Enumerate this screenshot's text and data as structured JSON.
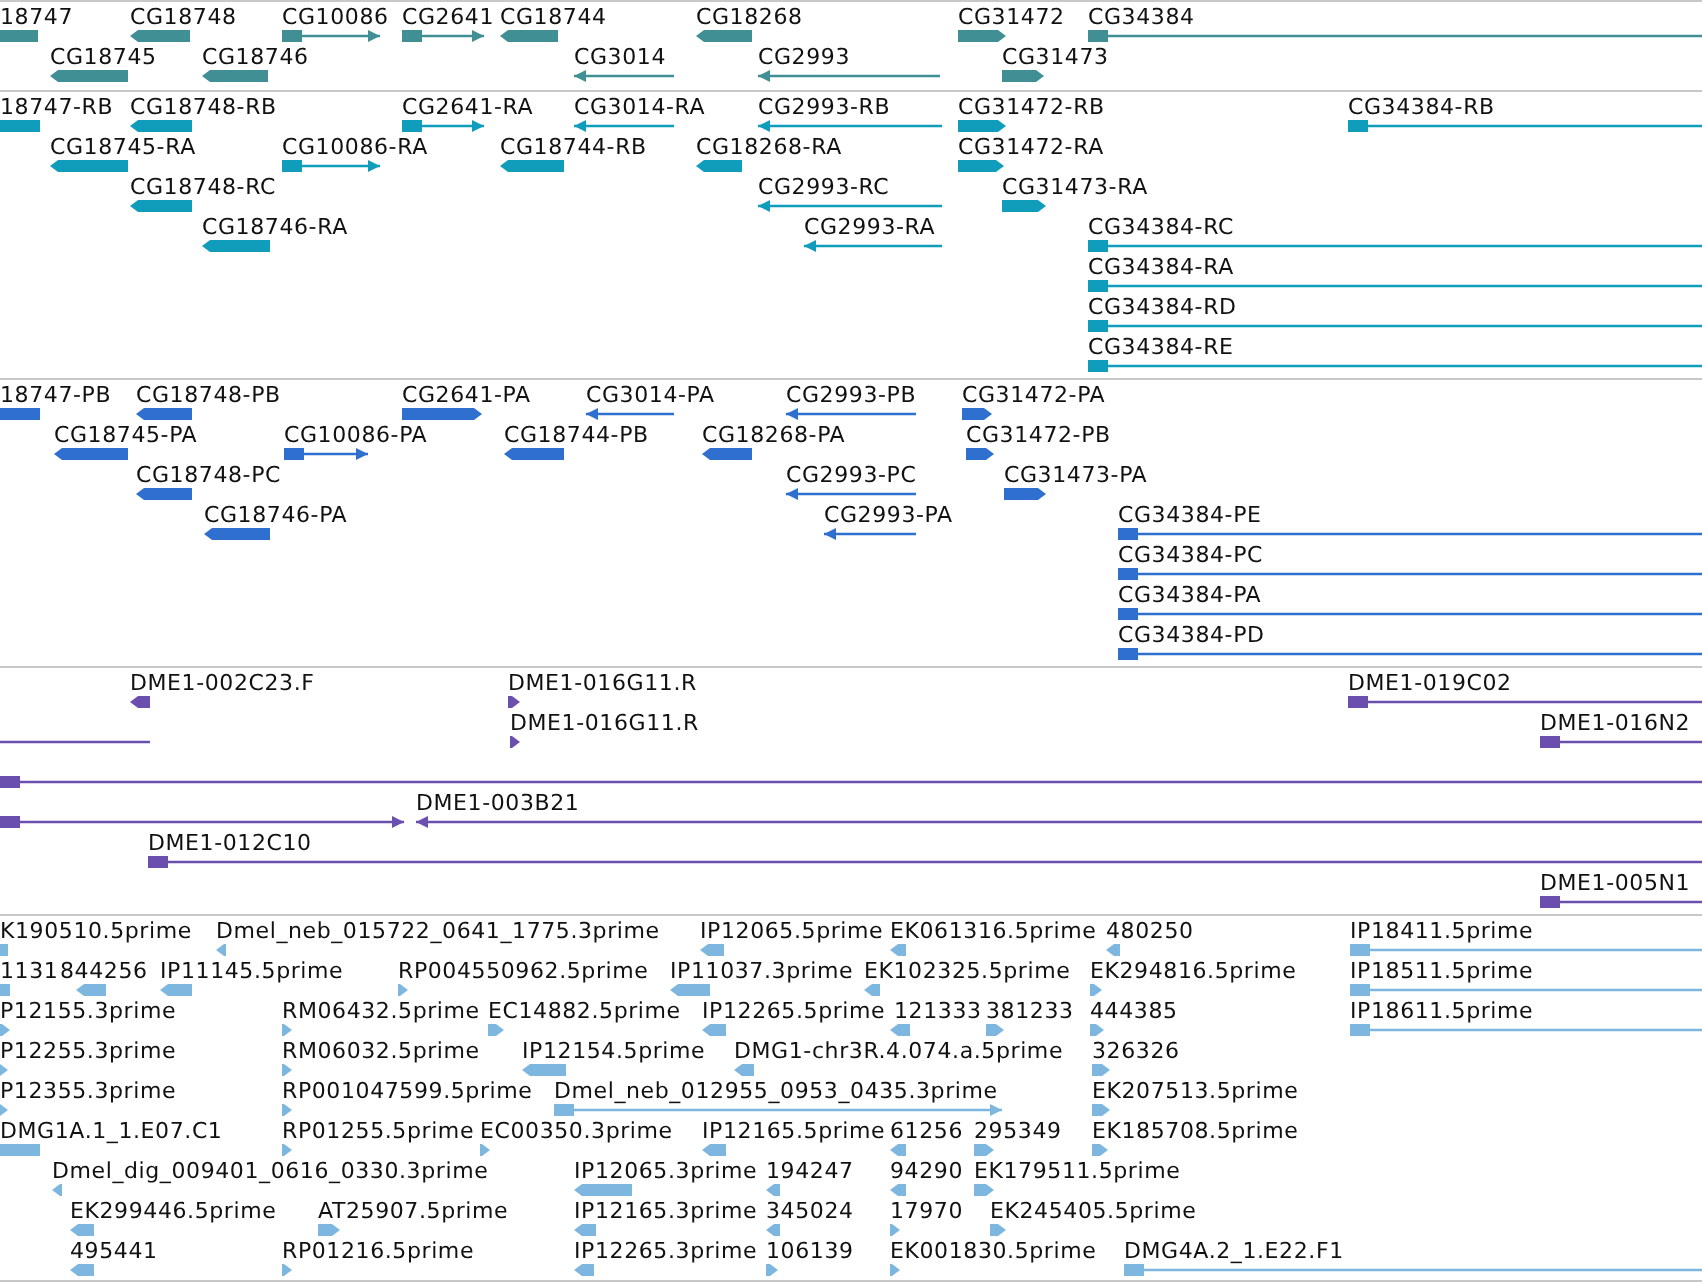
{
  "tracks": [
    {
      "color": "#3f8f94",
      "features": [
        {
          "label": "18747",
          "reverse_strand": true
        },
        {
          "label": "CG18748",
          "reverse_strand": true
        },
        {
          "label": "CG10086",
          "reverse_strand": false
        },
        {
          "label": "CG2641",
          "reverse_strand": false
        },
        {
          "label": "CG18744",
          "reverse_strand": true
        },
        {
          "label": "CG18268",
          "reverse_strand": true
        },
        {
          "label": "CG31472",
          "reverse_strand": false
        },
        {
          "label": "CG34384",
          "reverse_strand": false
        },
        {
          "label": "CG18745",
          "reverse_strand": true
        },
        {
          "label": "CG18746",
          "reverse_strand": true
        },
        {
          "label": "CG3014",
          "reverse_strand": true
        },
        {
          "label": "CG2993",
          "reverse_strand": true
        },
        {
          "label": "CG31473",
          "reverse_strand": false
        }
      ]
    },
    {
      "color": "#0f9dbb",
      "features": [
        {
          "label": "18747-RB",
          "reverse_strand": true
        },
        {
          "label": "CG18748-RB",
          "reverse_strand": true
        },
        {
          "label": "CG2641-RA",
          "reverse_strand": false
        },
        {
          "label": "CG3014-RA",
          "reverse_strand": true
        },
        {
          "label": "CG2993-RB",
          "reverse_strand": true
        },
        {
          "label": "CG31472-RB",
          "reverse_strand": false
        },
        {
          "label": "CG34384-RB",
          "reverse_strand": false
        },
        {
          "label": "CG18745-RA",
          "reverse_strand": true
        },
        {
          "label": "CG10086-RA",
          "reverse_strand": false
        },
        {
          "label": "CG18744-RB",
          "reverse_strand": true
        },
        {
          "label": "CG18268-RA",
          "reverse_strand": true
        },
        {
          "label": "CG31472-RA",
          "reverse_strand": false
        },
        {
          "label": "CG18748-RC",
          "reverse_strand": true
        },
        {
          "label": "CG2993-RC",
          "reverse_strand": true
        },
        {
          "label": "CG31473-RA",
          "reverse_strand": false
        },
        {
          "label": "CG18746-RA",
          "reverse_strand": true
        },
        {
          "label": "CG2993-RA",
          "reverse_strand": true
        },
        {
          "label": "CG34384-RC",
          "reverse_strand": false
        },
        {
          "label": "CG34384-RA",
          "reverse_strand": false
        },
        {
          "label": "CG34384-RD",
          "reverse_strand": false
        },
        {
          "label": "CG34384-RE",
          "reverse_strand": false
        }
      ]
    },
    {
      "color": "#2f6fd0",
      "features": [
        {
          "label": "18747-PB",
          "reverse_strand": true
        },
        {
          "label": "CG18748-PB",
          "reverse_strand": true
        },
        {
          "label": "CG2641-PA",
          "reverse_strand": false
        },
        {
          "label": "CG3014-PA",
          "reverse_strand": true
        },
        {
          "label": "CG2993-PB",
          "reverse_strand": true
        },
        {
          "label": "CG31472-PA",
          "reverse_strand": false
        },
        {
          "label": "CG18745-PA",
          "reverse_strand": true
        },
        {
          "label": "CG10086-PA",
          "reverse_strand": false
        },
        {
          "label": "CG18744-PB",
          "reverse_strand": true
        },
        {
          "label": "CG18268-PA",
          "reverse_strand": true
        },
        {
          "label": "CG31472-PB",
          "reverse_strand": false
        },
        {
          "label": "CG18748-PC",
          "reverse_strand": true
        },
        {
          "label": "CG2993-PC",
          "reverse_strand": true
        },
        {
          "label": "CG31473-PA",
          "reverse_strand": false
        },
        {
          "label": "CG18746-PA",
          "reverse_strand": true
        },
        {
          "label": "CG2993-PA",
          "reverse_strand": true
        },
        {
          "label": "CG34384-PE",
          "reverse_strand": false
        },
        {
          "label": "CG34384-PC",
          "reverse_strand": false
        },
        {
          "label": "CG34384-PA",
          "reverse_strand": false
        },
        {
          "label": "CG34384-PD",
          "reverse_strand": false
        }
      ]
    },
    {
      "color": "#6a4fae",
      "features": [
        {
          "label": "DME1-002C23.F",
          "reverse_strand": true
        },
        {
          "label": "DME1-016G11.R",
          "reverse_strand": false
        },
        {
          "label": "DME1-019C02",
          "reverse_strand": false
        },
        {
          "reverse_strand": true
        },
        {
          "label": "DME1-016G11.R",
          "reverse_strand": false
        },
        {
          "label": "DME1-016N2",
          "reverse_strand": false
        },
        {
          "reverse_strand": false
        },
        {
          "reverse_strand": false
        },
        {
          "label": "DME1-003B21",
          "reverse_strand": true
        },
        {
          "label": "DME1-012C10",
          "reverse_strand": false
        },
        {
          "label": "DME1-005N1",
          "reverse_strand": false
        }
      ]
    },
    {
      "color": "#7db7e0",
      "features": [
        {
          "label": "K190510.5prime",
          "reverse_strand": true
        },
        {
          "label": "Dmel_neb_015722_0641_1775.3prime",
          "reverse_strand": true
        },
        {
          "label": "IP12065.5prime",
          "reverse_strand": true
        },
        {
          "label": "EK061316.5prime",
          "reverse_strand": true
        },
        {
          "label": "480250",
          "reverse_strand": true
        },
        {
          "label": "IP18411.5prime",
          "reverse_strand": false
        },
        {
          "label": "1131",
          "reverse_strand": true
        },
        {
          "label": "844256",
          "reverse_strand": true
        },
        {
          "label": "IP11145.5prime",
          "reverse_strand": true
        },
        {
          "label": "RP004550962.5prime",
          "reverse_strand": false
        },
        {
          "label": "IP11037.3prime",
          "reverse_strand": true
        },
        {
          "label": "EK102325.5prime",
          "reverse_strand": true
        },
        {
          "label": "EK294816.5prime",
          "reverse_strand": false
        },
        {
          "label": "IP18511.5prime",
          "reverse_strand": false
        },
        {
          "label": "P12155.3prime",
          "reverse_strand": false
        },
        {
          "label": "RM06432.5prime",
          "reverse_strand": false
        },
        {
          "label": "EC14882.5prime",
          "reverse_strand": false
        },
        {
          "label": "IP12265.5prime",
          "reverse_strand": true
        },
        {
          "label": "121333",
          "reverse_strand": true
        },
        {
          "label": "381233",
          "reverse_strand": false
        },
        {
          "label": "444385",
          "reverse_strand": false
        },
        {
          "label": "IP18611.5prime",
          "reverse_strand": false
        },
        {
          "label": "P12255.3prime",
          "reverse_strand": false
        },
        {
          "label": "RM06032.5prime",
          "reverse_strand": false
        },
        {
          "label": "IP12154.5prime",
          "reverse_strand": true
        },
        {
          "label": "DMG1-chr3R.4.074.a.5prime",
          "reverse_strand": true
        },
        {
          "label": "326326",
          "reverse_strand": false
        },
        {
          "label": "P12355.3prime",
          "reverse_strand": false
        },
        {
          "label": "RP001047599.5prime",
          "reverse_strand": false
        },
        {
          "label": "Dmel_neb_012955_0953_0435.3prime",
          "reverse_strand": false
        },
        {
          "label": "EK207513.5prime",
          "reverse_strand": false
        },
        {
          "label": "DMG1A.1_1.E07.C1",
          "reverse_strand": true
        },
        {
          "label": "RP01255.5prime",
          "reverse_strand": false
        },
        {
          "label": "EC00350.3prime",
          "reverse_strand": false
        },
        {
          "label": "IP12165.5prime",
          "reverse_strand": true
        },
        {
          "label": "61256",
          "reverse_strand": true
        },
        {
          "label": "295349",
          "reverse_strand": false
        },
        {
          "label": "EK185708.5prime",
          "reverse_strand": false
        },
        {
          "label": "Dmel_dig_009401_0616_0330.3prime",
          "reverse_strand": true
        },
        {
          "label": "IP12065.3prime",
          "reverse_strand": true
        },
        {
          "label": "194247",
          "reverse_strand": true
        },
        {
          "label": "94290",
          "reverse_strand": true
        },
        {
          "label": "EK179511.5prime",
          "reverse_strand": false
        },
        {
          "label": "EK299446.5prime",
          "reverse_strand": true
        },
        {
          "label": "AT25907.5prime",
          "reverse_strand": false
        },
        {
          "label": "IP12165.3prime",
          "reverse_strand": true
        },
        {
          "label": "345024",
          "reverse_strand": true
        },
        {
          "label": "17970",
          "reverse_strand": false
        },
        {
          "label": "EK245405.5prime",
          "reverse_strand": false
        },
        {
          "label": "495441",
          "reverse_strand": true
        },
        {
          "label": "RP01216.5prime",
          "reverse_strand": false
        },
        {
          "label": "IP12265.3prime",
          "reverse_strand": true
        },
        {
          "label": "106139",
          "reverse_strand": false
        },
        {
          "label": "EK001830.5prime",
          "reverse_strand": false
        },
        {
          "label": "DMG4A.2_1.E22.F1",
          "reverse_strand": false
        }
      ]
    }
  ]
}
